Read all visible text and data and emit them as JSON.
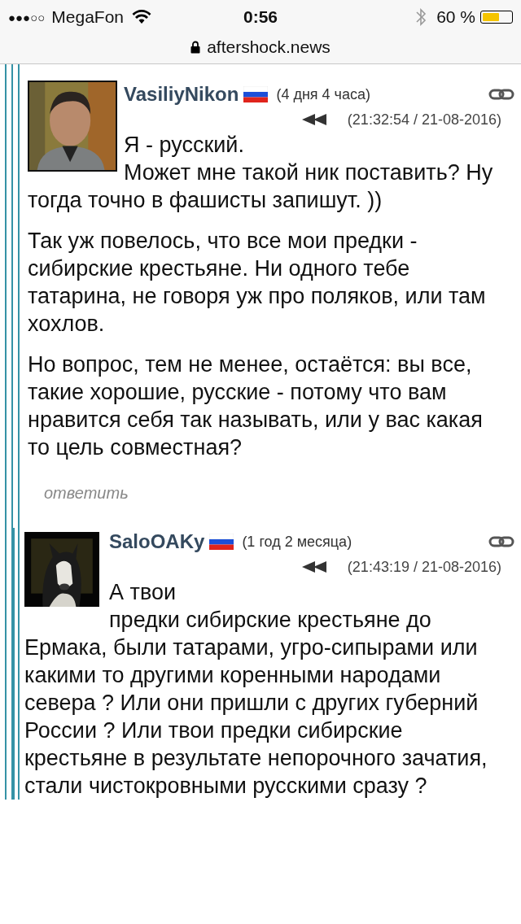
{
  "status_bar": {
    "signal_bars": "●●●○○",
    "carrier": "MegaFon",
    "time": "0:56",
    "battery": "60 %",
    "level": 0.6
  },
  "address_bar": {
    "url": "aftershock.news"
  },
  "comments": [
    {
      "author": "VasiliyNikon",
      "age": "(4 дня 4 часа)",
      "timestamp": "(21:32:54 / 21-08-2016)",
      "paragraphs": [
        "Я - русский.\nМожет мне такой ник поставить? Ну тогда точно в фашисты запишут. ))",
        "Так уж повелось, что все мои предки - сибирские крестьяне. Ни одного тебе татарина, не говоря уж про поляков, или там хохлов.",
        "Но вопрос, тем не менее, остаётся: вы все, такие хорошие, русские - потому что вам нравится себя так называть, или у вас какая то цель совместная?"
      ],
      "reply": "ответить",
      "children": [
        {
          "author": "SaloOAKy",
          "age": "(1 год 2 месяца)",
          "timestamp": "(21:43:19 / 21-08-2016)",
          "paragraphs": [
            "А твои\nпредки сибирские крестьяне до Ермака, были татарами, угро-сипырами или какими то другими коренными народами севера ? Или они пришли с других губерний России ? Или твои предки сибирские крестьяне в результате непорочного зачатия, стали чистокровными русскими сразу ?"
          ]
        }
      ]
    }
  ]
}
